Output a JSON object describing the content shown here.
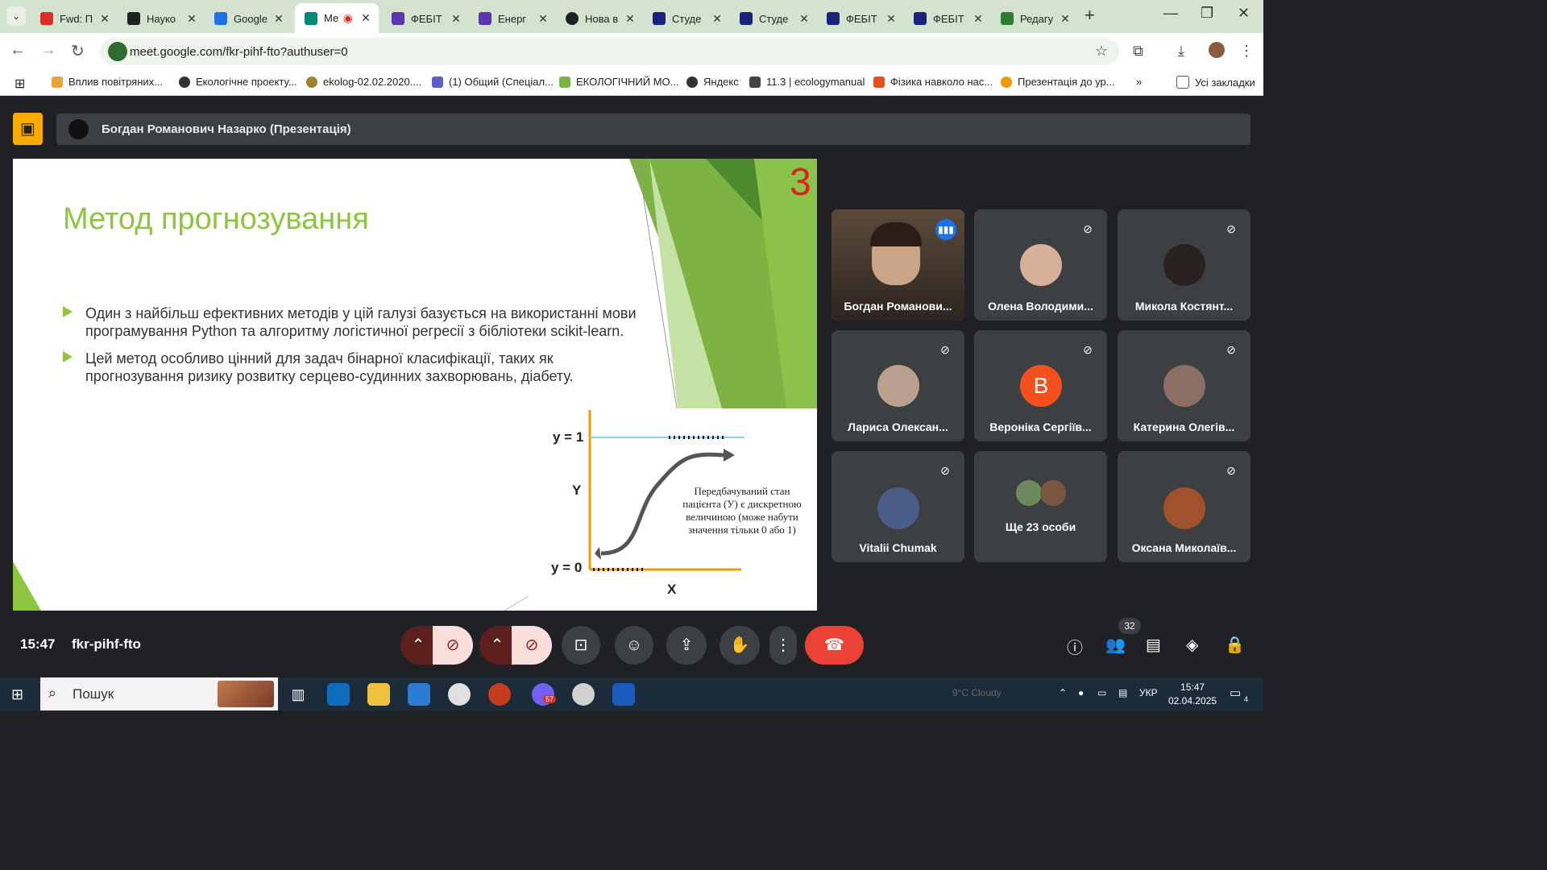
{
  "browser": {
    "tabs": [
      {
        "label": "Fwd: П",
        "color": "#d93025"
      },
      {
        "label": "Науко",
        "color": "#202124"
      },
      {
        "label": "Google",
        "color": "#1a73e8"
      },
      {
        "label": "Ме",
        "color": "#00897b",
        "active": true
      },
      {
        "label": "ФЕБІТ",
        "color": "#5e35b1"
      },
      {
        "label": "Енерг",
        "color": "#5e35b1"
      },
      {
        "label": "Нова в",
        "color": "#202124"
      },
      {
        "label": "Студе",
        "color": "#1a237e"
      },
      {
        "label": "Студе",
        "color": "#1a237e"
      },
      {
        "label": "ФЕБІТ",
        "color": "#1a237e"
      },
      {
        "label": "ФЕБІТ",
        "color": "#1a237e"
      },
      {
        "label": "Редагу",
        "color": "#2e7d32"
      }
    ],
    "url": "meet.google.com/fkr-pihf-fto?authuser=0",
    "bookmarks": [
      "Вплив повітряних...",
      "Екологічне проекту...",
      "ekolog-02.02.2020....",
      "(1) Общий (Спеціал...",
      "ЕКОЛОГІЧНИЙ МО...",
      "Яндекс",
      "11.3 | ecologymanual",
      "Фізика навколо нас...",
      "Презентація до ур..."
    ],
    "all_bookmarks": "Усі закладки"
  },
  "meet": {
    "presenter_title": "Богдан Романович Назарко (Презентація)",
    "slide": {
      "title": "Метод прогнозування",
      "number": "3",
      "bullets": [
        "Один з найбільш ефективних методів у цій галузі базується на використанні мови програмування Python та алгоритму логістичної регресії з бібліотеки scikit-learn.",
        "Цей метод особливо цінний для задач бінарної класифікації, таких як прогнозування ризику розвитку серцево-судинних захворювань, діабету."
      ],
      "graph": {
        "y1": "y = 1",
        "y0": "y = 0",
        "ylabel": "Y",
        "xlabel": "X",
        "note": "Передбачуваний стан пацієнта (У) є дискретною величиною (може набути значення тільки 0 або 1)"
      }
    },
    "participants": [
      {
        "name": "Богдан Романови...",
        "speaking": true
      },
      {
        "name": "Олена Володими...",
        "muted": true
      },
      {
        "name": "Микола Костянт...",
        "muted": true
      },
      {
        "name": "Лариса Олексан...",
        "muted": true
      },
      {
        "name": "Вероніка Сергіїв...",
        "muted": true,
        "initial": "В"
      },
      {
        "name": "Катерина Олегів...",
        "muted": true
      },
      {
        "name": "Vitalii Chumak",
        "muted": true
      },
      {
        "name": "Ще 23 особи"
      },
      {
        "name": "Оксана Миколаїв...",
        "muted": true
      }
    ],
    "time": "15:47",
    "meeting_code": "fkr-pihf-fto",
    "people_count": "32"
  },
  "taskbar": {
    "search": "Пошук",
    "weather": "9°C Cloudy",
    "lang": "УКР",
    "time": "15:47",
    "date": "02.04.2025",
    "notif": "4",
    "viber_badge": "57"
  }
}
